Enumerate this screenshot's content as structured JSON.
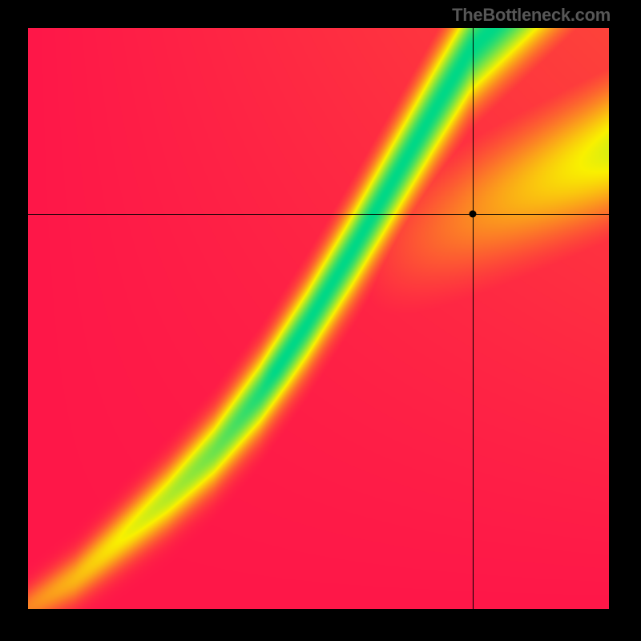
{
  "attribution": "TheBottleneck.com",
  "chart_data": {
    "type": "heatmap",
    "title": "",
    "xlabel": "",
    "ylabel": "",
    "xlim": [
      0,
      1
    ],
    "ylim": [
      0,
      1
    ],
    "colormap_description": "Compatibility heatmap: green = optimal pairing, yellow = acceptable, red = heavy bottleneck. Optimal ridge rises superlinearly from origin, curving up-right.",
    "color_stops": [
      {
        "t": 0.0,
        "color": "#ff1749"
      },
      {
        "t": 0.5,
        "color": "#f9f100"
      },
      {
        "t": 1.0,
        "color": "#00d887"
      }
    ],
    "crosshair": {
      "x": 0.766,
      "y": 0.68
    },
    "marker": {
      "x": 0.766,
      "y": 0.68
    },
    "ridge_control_points": [
      {
        "x": 0.0,
        "y": 0.0
      },
      {
        "x": 0.08,
        "y": 0.05
      },
      {
        "x": 0.16,
        "y": 0.12
      },
      {
        "x": 0.24,
        "y": 0.19
      },
      {
        "x": 0.32,
        "y": 0.27
      },
      {
        "x": 0.4,
        "y": 0.37
      },
      {
        "x": 0.48,
        "y": 0.49
      },
      {
        "x": 0.56,
        "y": 0.62
      },
      {
        "x": 0.63,
        "y": 0.74
      },
      {
        "x": 0.7,
        "y": 0.86
      },
      {
        "x": 0.76,
        "y": 0.96
      },
      {
        "x": 0.8,
        "y": 1.0
      }
    ],
    "ridge_halfwidth_base": 0.028,
    "ridge_halfwidth_gain": 0.055,
    "secondary_band": {
      "enabled": true,
      "slope": 0.46,
      "intercept": 0.33,
      "halfwidth": 0.075,
      "peak": 0.56,
      "start_x": 0.55
    }
  }
}
